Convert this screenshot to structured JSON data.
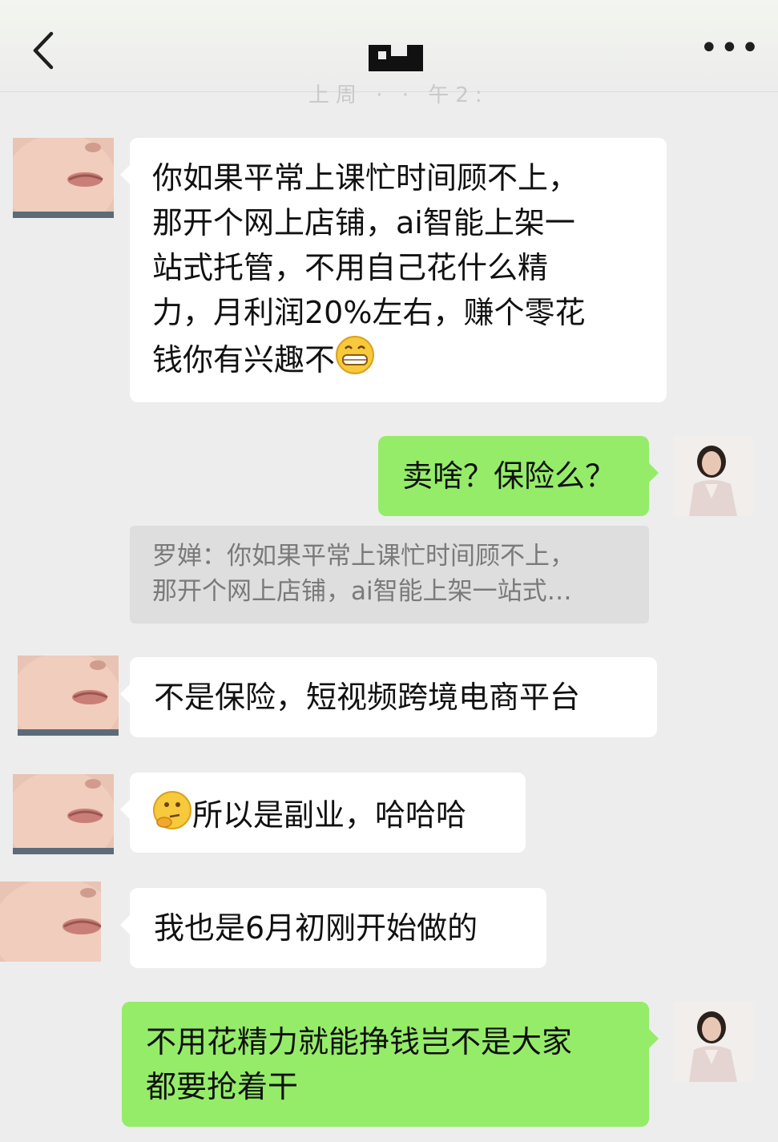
{
  "header": {
    "back_icon": "chevron-left-icon",
    "more_label": "•••",
    "ghost_time": "上周 · · 午2:"
  },
  "messages": [
    {
      "side": "them",
      "text": "你如果平常上课忙时间顾不上，那开个网上店铺，ai智能上架一站式托管，不用自己花什么精力，月利润20%左右，赚个零花钱你有兴趣不",
      "emoji_after": "grinning-face-icon"
    },
    {
      "side": "me",
      "text": "卖啥？保险么？"
    },
    {
      "quote": "罗婵：你如果平常上课忙时间顾不上，那开个网上店铺，ai智能上架一站式…"
    },
    {
      "side": "them",
      "text": "不是保险，短视频跨境电商平台"
    },
    {
      "side": "them",
      "text": "所以是副业，哈哈哈",
      "emoji_before": "thinking-face-icon"
    },
    {
      "side": "them",
      "text": "我也是6月初刚开始做的"
    },
    {
      "side": "me",
      "text": "不用花精力就能挣钱岂不是大家都要抢着干"
    }
  ],
  "lines": {
    "m1": [
      "你如果平常上课忙时间顾不上，",
      "那开个网上店铺，ai智能上架一",
      "站式托管，不用自己花什么精",
      "力，月利润20%左右，赚个零花",
      "钱你有兴趣不"
    ],
    "m7": [
      "不用花精力就能挣钱岂不是大家",
      "都要抢着干"
    ],
    "quote": [
      "罗婵：你如果平常上课忙时间顾不上，",
      "那开个网上店铺，ai智能上架一站式…"
    ]
  },
  "colors": {
    "my_bubble": "#95ec69",
    "their_bubble": "#ffffff",
    "background": "#ededed",
    "quote_bg": "#dedede"
  }
}
